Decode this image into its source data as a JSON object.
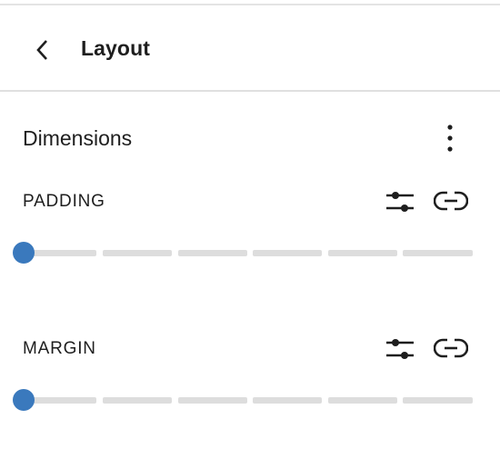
{
  "header": {
    "title": "Layout"
  },
  "dimensions": {
    "title": "Dimensions",
    "controls": [
      {
        "label": "PADDING",
        "value_fraction": 0
      },
      {
        "label": "MARGIN",
        "value_fraction": 0
      }
    ]
  },
  "icons": {
    "back": "chevron-left-icon",
    "options": "more-vertical-icon",
    "custom": "sliders-icon",
    "link": "link-icon"
  },
  "colors": {
    "accent": "#3a79bd",
    "track": "#dddddd",
    "text": "#1e1e1e",
    "divider": "#e0e0e0"
  }
}
